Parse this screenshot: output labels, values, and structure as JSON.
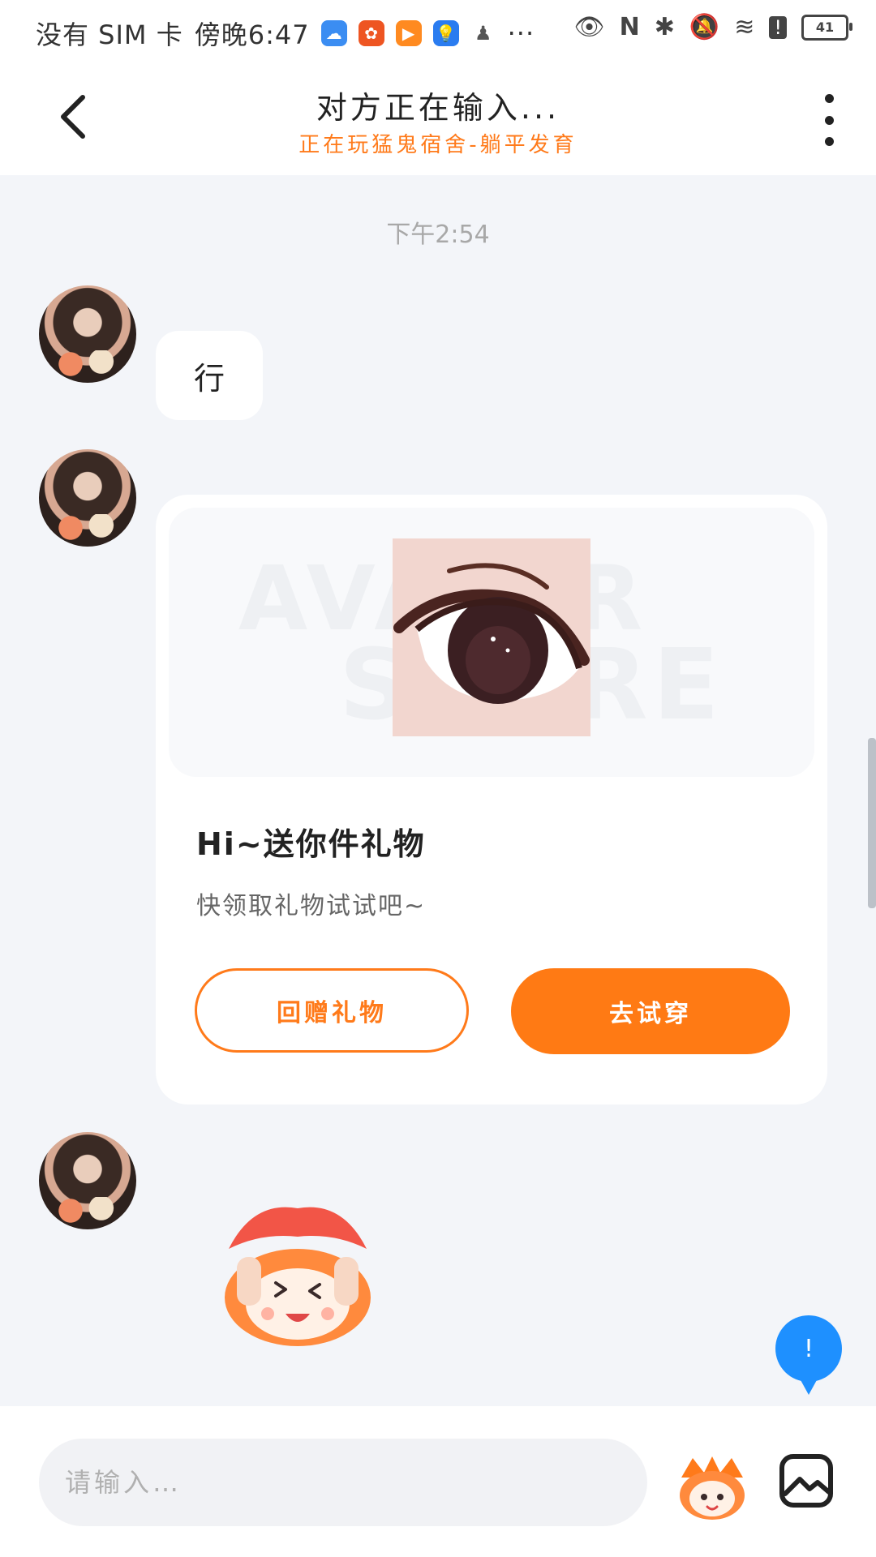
{
  "status_bar": {
    "carrier": "没有 SIM 卡",
    "time": "傍晚6:47",
    "battery": "41",
    "more": "···"
  },
  "header": {
    "back_icon": "chevron-left-icon",
    "title": "对方正在输入...",
    "subtitle": "正在玩猛鬼宿舍-躺平发育",
    "more_icon": "more-vertical-icon"
  },
  "chat": {
    "timestamp": "下午2:54",
    "text_message": "行",
    "gift_card": {
      "title": "Hi~送你件礼物",
      "description": "快领取礼物试试吧~",
      "watermark_line1": "AVATAR",
      "watermark_line2": "STORE",
      "return_gift_label": "回赠礼物",
      "try_on_label": "去试穿"
    }
  },
  "float_button": {
    "label": "!"
  },
  "input_bar": {
    "placeholder": "请输入…",
    "emoji_icon": "mascot-emoji-icon",
    "image_icon": "image-icon"
  },
  "colors": {
    "accent": "#ff7a1a",
    "background": "#f3f5f9",
    "float_button": "#1e90ff"
  }
}
